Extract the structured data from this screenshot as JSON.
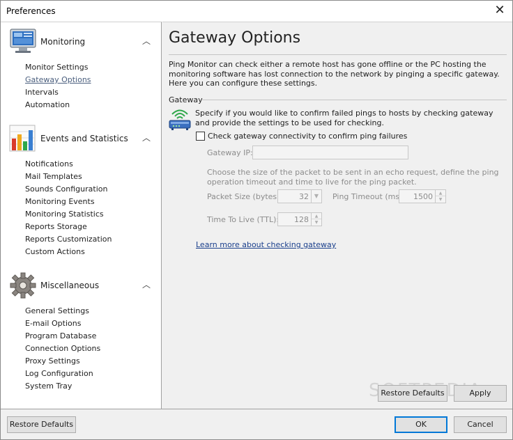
{
  "window": {
    "title": "Preferences"
  },
  "sidebar": {
    "sections": [
      {
        "title": "Monitoring",
        "icon": "monitor-icon",
        "items": [
          "Monitor Settings",
          "Gateway Options",
          "Intervals",
          "Automation"
        ]
      },
      {
        "title": "Events and Statistics",
        "icon": "bar-chart-icon",
        "items": [
          "Notifications",
          "Mail Templates",
          "Sounds Configuration",
          "Monitoring Events",
          "Monitoring Statistics",
          "Reports Storage",
          "Reports Customization",
          "Custom Actions"
        ]
      },
      {
        "title": "Miscellaneous",
        "icon": "gear-icon",
        "items": [
          "General Settings",
          "E-mail Options",
          "Program Database",
          "Connection Options",
          "Proxy Settings",
          "Log Configuration",
          "System Tray"
        ]
      }
    ],
    "active_item": "Gateway Options"
  },
  "content": {
    "title": "Gateway Options",
    "intro": "Ping Monitor can check either a remote host has gone offline or the PC hosting the monitoring software has lost connection to the network by pinging a specific gateway. Here you can configure these settings.",
    "group_label": "Gateway",
    "group_desc": "Specify if you would like to confirm failed pings to hosts by checking gateway and provide the settings to be used for checking.",
    "checkbox_label": "Check gateway connectivity to confirm ping failures",
    "checkbox_checked": false,
    "gateway_ip_label": "Gateway IP:",
    "gateway_ip_value": "",
    "packet_desc": "Choose the size of the packet to be sent in an echo request, define the ping operation timeout and time to live for the ping packet.",
    "packet_size_label": "Packet Size (bytes):",
    "packet_size_value": "32",
    "ping_timeout_label": "Ping Timeout (ms):",
    "ping_timeout_value": "1500",
    "ttl_label": "Time To Live (TTL):",
    "ttl_value": "128",
    "link_text": "Learn more about checking gateway",
    "restore_defaults": "Restore Defaults",
    "apply": "Apply"
  },
  "watermark": "SOFTPEDIA",
  "footer": {
    "restore_defaults": "Restore Defaults",
    "ok": "OK",
    "cancel": "Cancel"
  },
  "colors": {
    "accent": "#0078d7",
    "link": "#1a3f8c",
    "active_nav": "#4b5f7e"
  }
}
